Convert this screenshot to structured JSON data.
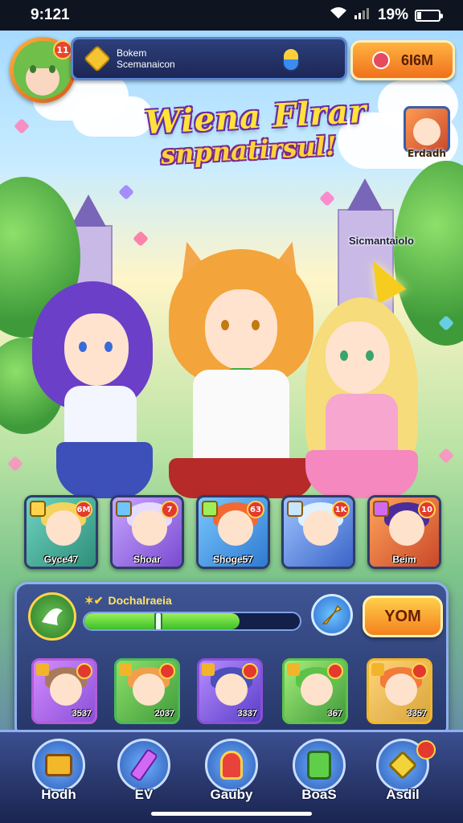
{
  "status_bar": {
    "time": "9:121",
    "battery": "19%"
  },
  "player": {
    "level": "11",
    "name_line1": "Bokem",
    "name_line2": "Scemanaicon"
  },
  "currency": {
    "label": "6I6M"
  },
  "title": {
    "main": "Wiena Flrar",
    "sub": "snpnatirsul!"
  },
  "side_event": {
    "label": "Erdadh"
  },
  "floating_reward": {
    "label": "Sicmantaiolo"
  },
  "roster": [
    {
      "label": "Gyce47",
      "level": "6M",
      "hair": "#f4d35e",
      "bg": "#4fb7a0"
    },
    {
      "label": "Shoar",
      "level": "7",
      "hair": "#d0b8ff",
      "bg": "#9d6de0"
    },
    {
      "label": "Shoge57",
      "level": "63",
      "hair": "#f26a32",
      "bg": "#4aa7e0"
    },
    {
      "label": "",
      "level": "1K",
      "hair": "#c9e6ff",
      "bg": "#5a8fe6"
    },
    {
      "label": "Beim",
      "level": "10",
      "hair": "#4b2d9a",
      "bg": "#e66f3a"
    }
  ],
  "quest": {
    "prefix": "✶✔",
    "title": "Dochalraeia",
    "progress": 0.72,
    "button": "YOM"
  },
  "team": [
    {
      "tag": "3537",
      "hair": "#a87a5a",
      "bg": "#b35bd8"
    },
    {
      "tag": "2037",
      "hair": "#f0a04a",
      "bg": "#4cb85a"
    },
    {
      "tag": "3337",
      "hair": "#4b4fb8",
      "bg": "#8a4fd8"
    },
    {
      "tag": "367",
      "hair": "#5ec248",
      "bg": "#3f9a3a"
    },
    {
      "tag": "3357",
      "hair": "#f27a3a",
      "bg": "#d8a53a"
    }
  ],
  "nav": [
    {
      "label": "Hodh",
      "icon": "treasure-chest-icon",
      "color": "#f2b72a"
    },
    {
      "label": "EV",
      "icon": "crystal-icon",
      "color": "#d269f2"
    },
    {
      "label": "Gauby",
      "icon": "trophy-icon",
      "color": "#e8423a"
    },
    {
      "label": "BoaS",
      "icon": "scroll-icon",
      "color": "#5fcf4a"
    },
    {
      "label": "Asdil",
      "icon": "gem-icon",
      "color": "#f2d33a"
    }
  ]
}
